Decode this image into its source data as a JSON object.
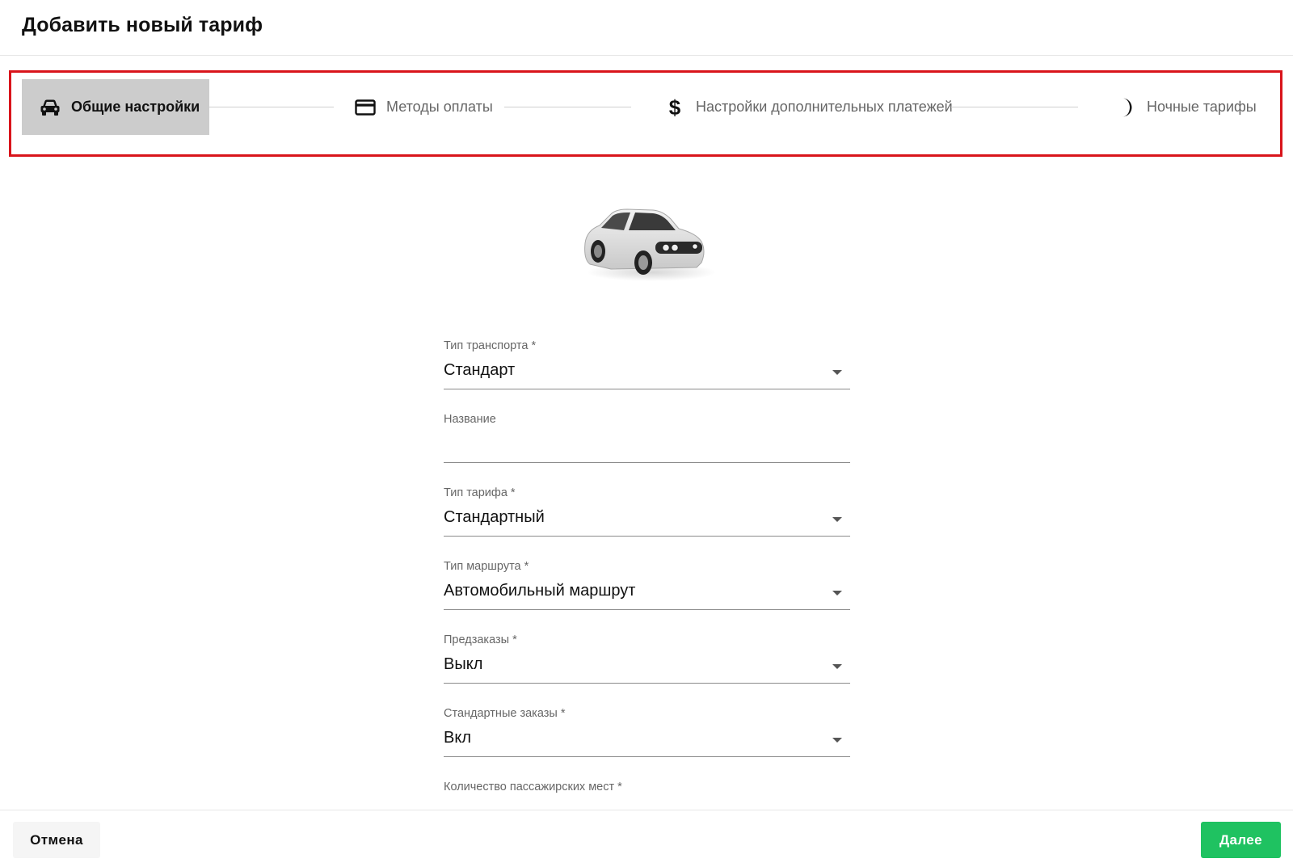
{
  "header": {
    "title": "Добавить новый тариф"
  },
  "stepper": {
    "steps": [
      {
        "label": "Общие настройки",
        "icon": "car-icon",
        "active": true
      },
      {
        "label": "Методы оплаты",
        "icon": "credit-card-icon",
        "active": false
      },
      {
        "label": "Настройки дополнительных платежей",
        "icon": "dollar-icon",
        "active": false
      },
      {
        "label": "Ночные тарифы",
        "icon": "moon-icon",
        "active": false
      }
    ]
  },
  "form": {
    "vehicle_type": {
      "label": "Тип транспорта *",
      "value": "Стандарт"
    },
    "name": {
      "label": "Название",
      "value": ""
    },
    "tariff_type": {
      "label": "Тип тарифа *",
      "value": "Стандартный"
    },
    "route_type": {
      "label": "Тип маршрута *",
      "value": "Автомобильный маршрут"
    },
    "preorders": {
      "label": "Предзаказы *",
      "value": "Выкл"
    },
    "standard_orders": {
      "label": "Стандартные заказы *",
      "value": "Вкл"
    },
    "passenger_seats": {
      "label": "Количество пассажирских мест *"
    }
  },
  "footer": {
    "cancel_label": "Отмена",
    "next_label": "Далее"
  },
  "colors": {
    "accent_green": "#1fc261",
    "highlight_red": "#d9141b",
    "active_step_bg": "#cccccc"
  }
}
